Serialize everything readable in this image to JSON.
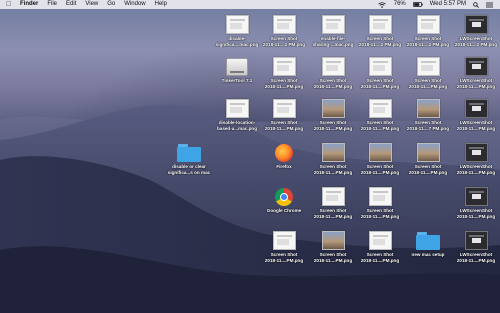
{
  "menubar": {
    "apple_icon": "apple-logo",
    "app_name": "Finder",
    "menus": [
      "File",
      "Edit",
      "View",
      "Go",
      "Window",
      "Help"
    ],
    "battery": "76%",
    "clock": "Wed 5:57 PM"
  },
  "desktop_icons": [
    {
      "id": "disable-significant",
      "label": "disable-\nsignifica....mac.png",
      "kind": "doc"
    },
    {
      "id": "ss-r1c2",
      "label": "Screen Shot\n2018-11....2 PM.png",
      "kind": "doc"
    },
    {
      "id": "enable-file-sharing",
      "label": "enable-file-\nsharing-...mac.png",
      "kind": "doc"
    },
    {
      "id": "ss-r1c4",
      "label": "Screen Shot\n2018-11....2 PM.png",
      "kind": "doc"
    },
    {
      "id": "ss-r1c5",
      "label": "Screen Shot\n2018-11....2 PM.png",
      "kind": "doc"
    },
    {
      "id": "lw-r1c6",
      "label": "LWScreenShot\n2018-11....2 PM.png",
      "kind": "dark"
    },
    {
      "id": "tinkertool",
      "label": "TinkerTool 7.1",
      "kind": "disk"
    },
    {
      "id": "ss-r2c2",
      "label": "Screen Shot\n2018-11....PM.png",
      "kind": "doc"
    },
    {
      "id": "ss-r2c3",
      "label": "Screen Shot\n2018-11....PM.png",
      "kind": "doc"
    },
    {
      "id": "ss-r2c4",
      "label": "Screen Shot\n2018-11....PM.png",
      "kind": "doc"
    },
    {
      "id": "ss-r2c5",
      "label": "Screen Shot\n2018-11....PM.png",
      "kind": "doc"
    },
    {
      "id": "lw-r2c6",
      "label": "LWScreenShot\n2018-11....PM.png",
      "kind": "dark"
    },
    {
      "id": "disable-location",
      "label": "disable-location-\nbased-a...mac.png",
      "kind": "doc"
    },
    {
      "id": "ss-r3c2",
      "label": "Screen Shot\n2018-11....PM.png",
      "kind": "doc"
    },
    {
      "id": "ss-r3c3",
      "label": "Screen Shot\n2018-11....PM.png",
      "kind": "photo"
    },
    {
      "id": "ss-r3c4",
      "label": "Screen Shot\n2018-11....PM.png",
      "kind": "doc"
    },
    {
      "id": "ss-r3c5",
      "label": "Screen Shot\n2018-11....7 PM.png",
      "kind": "photo"
    },
    {
      "id": "lw-r3c6",
      "label": "LWScreenShot\n2018-11....PM.png",
      "kind": "dark"
    },
    {
      "id": "disable-clear-folder",
      "label": "disable or clear\nsignifica...s on mac",
      "kind": "folder"
    },
    {
      "id": "firefox",
      "label": "Firefox",
      "kind": "firefox"
    },
    {
      "id": "ss-r4c3",
      "label": "Screen Shot\n2018-11....PM.png",
      "kind": "photo"
    },
    {
      "id": "ss-r4c4",
      "label": "Screen Shot\n2018-11....PM.png",
      "kind": "photo"
    },
    {
      "id": "ss-r4c5",
      "label": "Screen Shot\n2018-11....PM.png",
      "kind": "photo"
    },
    {
      "id": "lw-r4c6",
      "label": "LWScreenShot\n2018-11....PM.png",
      "kind": "dark"
    },
    {
      "id": "chrome",
      "label": "Google Chrome",
      "kind": "chrome"
    },
    {
      "id": "ss-r5c3",
      "label": "Screen Shot\n2018-11....PM.png",
      "kind": "doc"
    },
    {
      "id": "ss-r5c4",
      "label": "Screen Shot\n2018-11....PM.png",
      "kind": "doc"
    },
    {
      "id": "lw-r5c6",
      "label": "LWScreenShot\n2018-11....PM.png",
      "kind": "dark"
    },
    {
      "id": "ss-r6c2",
      "label": "Screen Shot\n2018-11....PM.png",
      "kind": "doc"
    },
    {
      "id": "ss-r6c3",
      "label": "Screen Shot\n2018-11....PM.png",
      "kind": "photo"
    },
    {
      "id": "ss-r6c4",
      "label": "Screen Shot\n2018-11....PM.png",
      "kind": "doc"
    },
    {
      "id": "new-mac-setup",
      "label": "new mac setup",
      "kind": "folder"
    },
    {
      "id": "lw-r6c6",
      "label": "LWScreenShot\n2018-11....PM.png",
      "kind": "dark"
    }
  ],
  "colors": {
    "menubar_bg": "#ececf0",
    "folder_blue": "#3ea4e6",
    "label_text": "#ffffff"
  }
}
